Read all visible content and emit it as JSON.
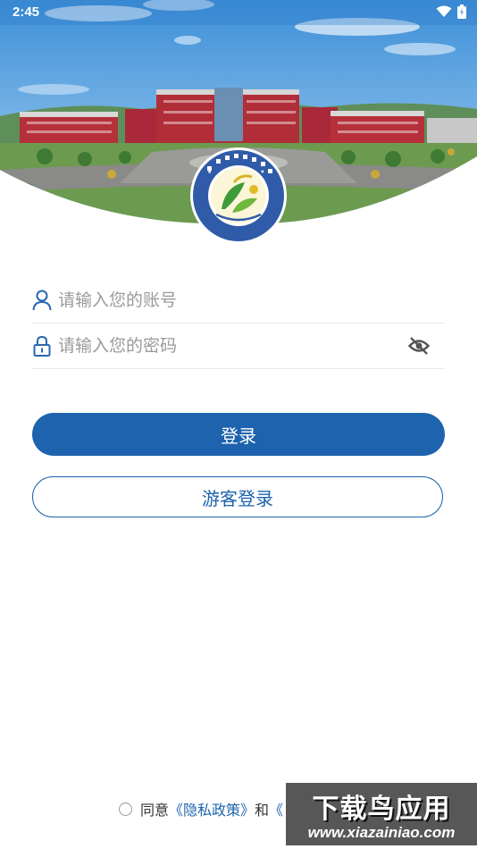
{
  "status_bar": {
    "time": "2:45"
  },
  "header": {
    "logo_icon": "school-emblem-icon"
  },
  "form": {
    "account_placeholder": "请输入您的账号",
    "password_placeholder": "请输入您的密码",
    "account_icon": "user-icon",
    "password_icon": "lock-icon",
    "visibility_icon": "eye-off-icon"
  },
  "buttons": {
    "login_label": "登录",
    "guest_login_label": "游客登录"
  },
  "agreement": {
    "prefix": "同意",
    "privacy_link": "《隐私政策》",
    "and": "和",
    "second_link": "《"
  },
  "watermark": {
    "title": "下载鸟应用",
    "url": "www.xiazainiao.com"
  },
  "colors": {
    "primary": "#1d63ae",
    "placeholder": "#9a9a9a",
    "divider": "#e8e8e8"
  }
}
